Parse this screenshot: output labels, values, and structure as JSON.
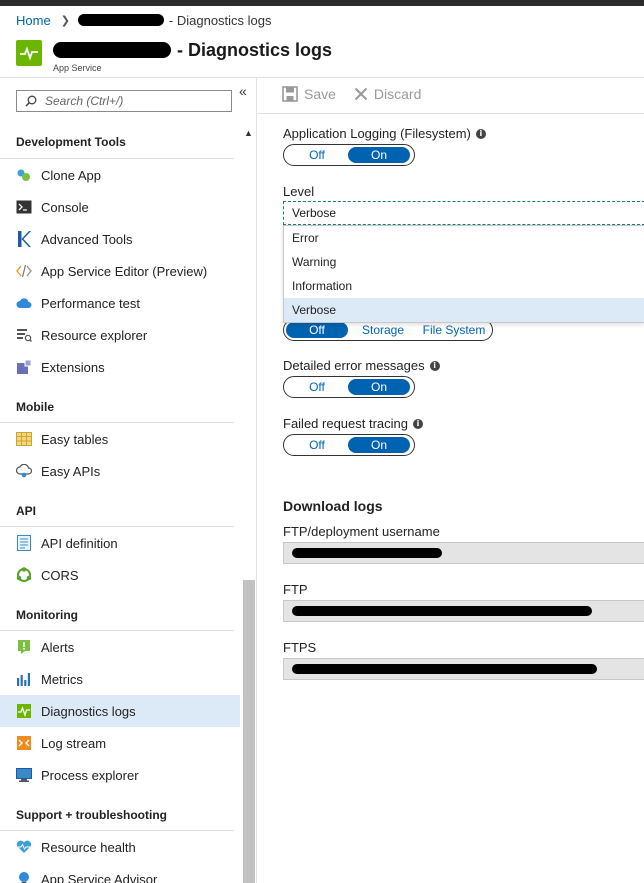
{
  "breadcrumb": {
    "home": "Home",
    "tail": "- Diagnostics logs"
  },
  "header": {
    "title_suffix": "- Diagnostics logs",
    "subtitle": "App Service"
  },
  "sidebar": {
    "search_placeholder": "Search (Ctrl+/)",
    "groups": [
      {
        "label": "Development Tools",
        "items": [
          "Clone App",
          "Console",
          "Advanced Tools",
          "App Service Editor (Preview)",
          "Performance test",
          "Resource explorer",
          "Extensions"
        ]
      },
      {
        "label": "Mobile",
        "items": [
          "Easy tables",
          "Easy APIs"
        ]
      },
      {
        "label": "API",
        "items": [
          "API definition",
          "CORS"
        ]
      },
      {
        "label": "Monitoring",
        "items": [
          "Alerts",
          "Metrics",
          "Diagnostics logs",
          "Log stream",
          "Process explorer"
        ]
      },
      {
        "label": "Support + troubleshooting",
        "items": [
          "Resource health",
          "App Service Advisor"
        ]
      }
    ],
    "active_item": "Diagnostics logs"
  },
  "toolbar": {
    "save": "Save",
    "discard": "Discard"
  },
  "settings": {
    "app_logging": {
      "label": "Application Logging (Filesystem)",
      "off": "Off",
      "on": "On",
      "selected": "On"
    },
    "level": {
      "label": "Level",
      "value": "Verbose",
      "options": [
        "Error",
        "Warning",
        "Information",
        "Verbose"
      ]
    },
    "web_server_logging": {
      "off": "Off",
      "storage": "Storage",
      "filesystem": "File System",
      "selected": "Off"
    },
    "detailed_errors": {
      "label": "Detailed error messages",
      "off": "Off",
      "on": "On",
      "selected": "On"
    },
    "failed_request": {
      "label": "Failed request tracing",
      "off": "Off",
      "on": "On",
      "selected": "On"
    }
  },
  "download_logs": {
    "title": "Download logs",
    "ftp_user_label": "FTP/deployment username",
    "ftp_label": "FTP",
    "ftps_label": "FTPS"
  },
  "colors": {
    "accent": "#0063b1",
    "app_icon": "#6bb700",
    "active_bg": "#dceaf8"
  }
}
